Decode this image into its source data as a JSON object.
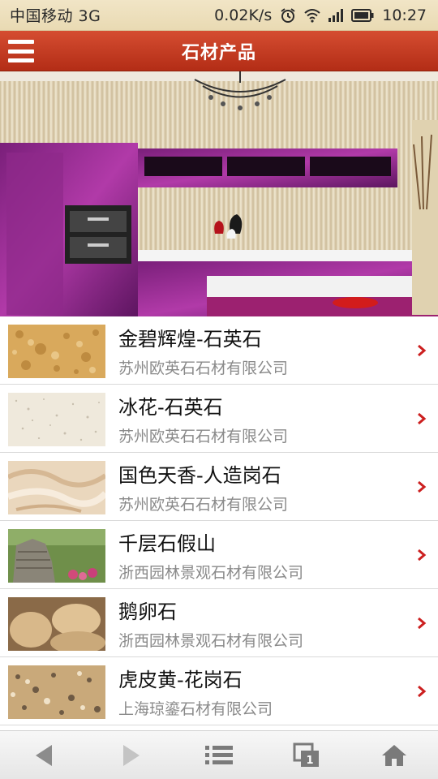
{
  "status_bar": {
    "carrier": "中国移动 3G",
    "speed": "0.02K/s",
    "time": "10:27",
    "icons": [
      "alarm-icon",
      "wifi-icon",
      "signal-icon",
      "battery-icon"
    ]
  },
  "header": {
    "title": "石材产品",
    "menu_icon": "menu-icon",
    "background_color": "#c63c22"
  },
  "banner": {
    "image": "kitchen-banner-photo"
  },
  "products": [
    {
      "name": "金碧辉煌-石英石",
      "company": "苏州欧英石石材有限公司",
      "thumb": "gold-quartz-stone"
    },
    {
      "name": "冰花-石英石",
      "company": "苏州欧英石石材有限公司",
      "thumb": "ice-flower-quartz-stone"
    },
    {
      "name": "国色天香-人造岗石",
      "company": "苏州欧英石石材有限公司",
      "thumb": "artificial-granite"
    },
    {
      "name": "千层石假山",
      "company": "浙西园林景观石材有限公司",
      "thumb": "layered-rockery"
    },
    {
      "name": "鹅卵石",
      "company": "浙西园林景观石材有限公司",
      "thumb": "pebbles"
    },
    {
      "name": "虎皮黄-花岗石",
      "company": "上海琼鎏石材有限公司",
      "thumb": "tiger-yellow-granite"
    }
  ],
  "toolbar": {
    "items": [
      "back-arrow-icon",
      "forward-arrow-icon",
      "list-icon",
      "windows-icon",
      "home-icon"
    ],
    "window_count": "1"
  },
  "colors": {
    "accent": "#c63c22",
    "chevron": "#cc1f1f",
    "secondary_text": "#8a8a8a"
  }
}
